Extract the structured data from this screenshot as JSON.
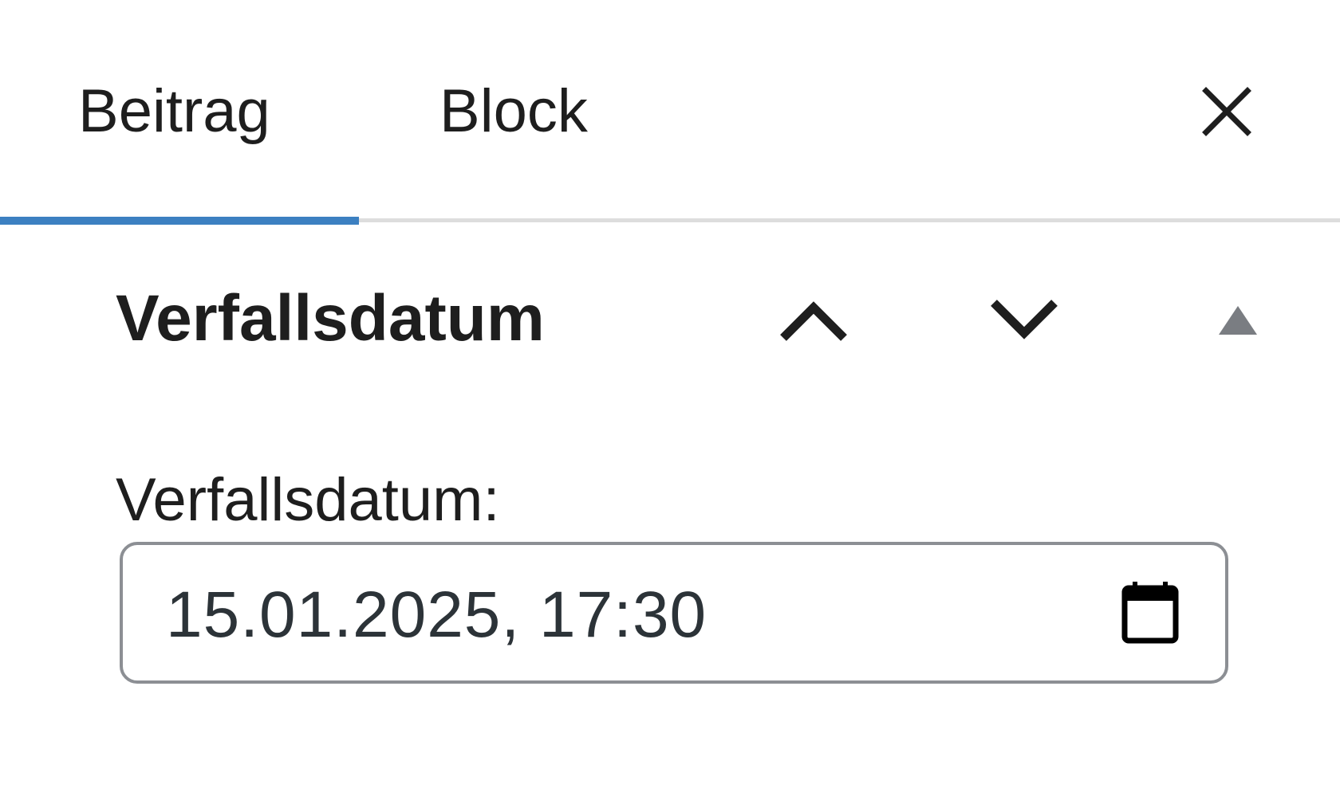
{
  "tabs": {
    "post_label": "Beitrag",
    "block_label": "Block",
    "active_tab": "Beitrag"
  },
  "panel": {
    "title": "Verfallsdatum",
    "field_label": "Verfallsdatum:",
    "date_value": "15.01.2025, 17:30"
  },
  "icons": {
    "close": "close-icon",
    "move_up": "chevron-up-icon",
    "move_down": "chevron-down-icon",
    "collapse": "triangle-up-icon",
    "calendar": "calendar-icon"
  },
  "colors": {
    "accent": "#3c80c1",
    "divider": "#dddddd",
    "input_border": "#8c8f94",
    "text": "#1e1e1e",
    "muted_icon": "#7a7d82"
  }
}
